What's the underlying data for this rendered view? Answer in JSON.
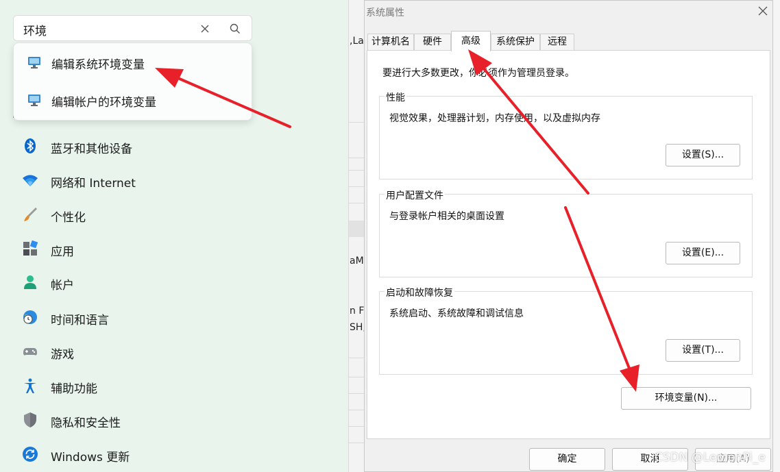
{
  "search": {
    "value": "环境"
  },
  "suggestions": [
    {
      "label": "编辑系统环境变量",
      "icon": "monitor-settings-icon"
    },
    {
      "label": "编辑帐户的环境变量",
      "icon": "monitor-settings-icon"
    }
  ],
  "nav": [
    {
      "label": "蓝牙和其他设备",
      "icon": "bluetooth-icon"
    },
    {
      "label": "网络和 Internet",
      "icon": "wifi-icon"
    },
    {
      "label": "个性化",
      "icon": "brush-icon"
    },
    {
      "label": "应用",
      "icon": "apps-icon"
    },
    {
      "label": "帐户",
      "icon": "person-icon"
    },
    {
      "label": "时间和语言",
      "icon": "globe-clock-icon"
    },
    {
      "label": "游戏",
      "icon": "gamepad-icon"
    },
    {
      "label": "辅助功能",
      "icon": "accessibility-icon"
    },
    {
      "label": "隐私和安全性",
      "icon": "shield-icon"
    },
    {
      "label": "Windows 更新",
      "icon": "update-icon"
    }
  ],
  "background_fragments": [
    ",Lau",
    "aM",
    "n Fi",
    "SH;"
  ],
  "dialog": {
    "title": "系统属性",
    "tabs": [
      "计算机名",
      "硬件",
      "高级",
      "系统保护",
      "远程"
    ],
    "active_tab": "高级",
    "admin_note": "要进行大多数更改，你必须作为管理员登录。",
    "groups": [
      {
        "title": "性能",
        "description": "视觉效果，处理器计划，内存使用，以及虚拟内存",
        "button": "设置(S)..."
      },
      {
        "title": "用户配置文件",
        "description": "与登录帐户相关的桌面设置",
        "button": "设置(E)..."
      },
      {
        "title": "启动和故障恢复",
        "description": "系统启动、系统故障和调试信息",
        "button": "设置(T)..."
      }
    ],
    "env_button": "环境变量(N)...",
    "ok_button": "确定",
    "cancel_button": "取消",
    "apply_button": "应用(A)"
  },
  "watermark": "CSDN @LemonPi_e",
  "colors": {
    "accent": "#0067c0",
    "arrow": "#e8202a",
    "settings_bg": "#e8f4ec"
  }
}
